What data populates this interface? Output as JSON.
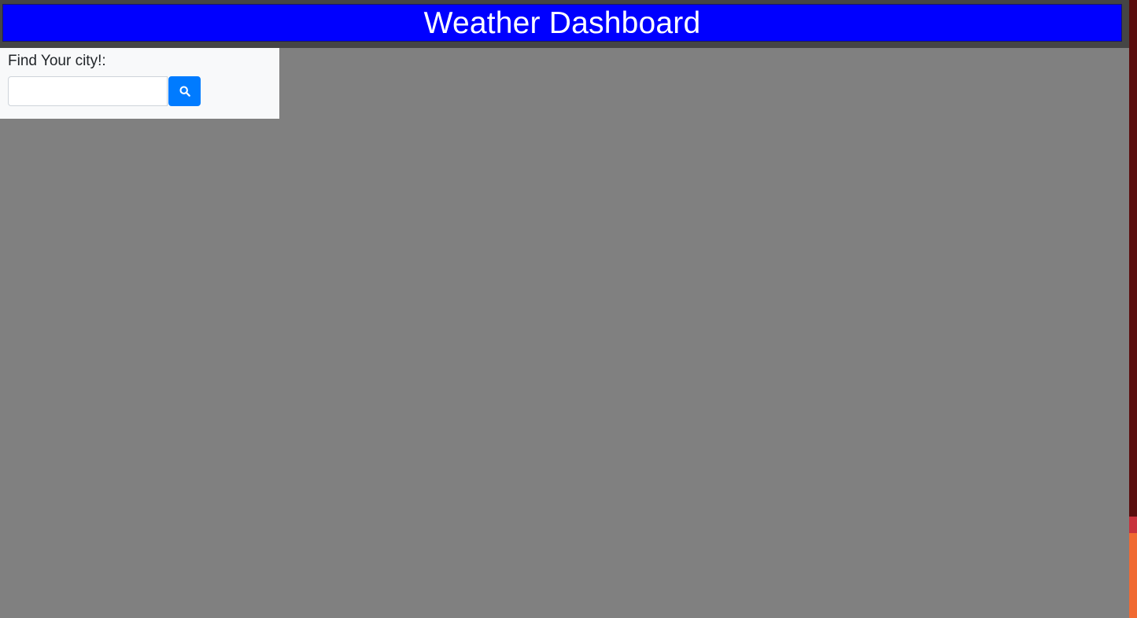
{
  "header": {
    "title": "Weather Dashboard",
    "background_color": "#0000ff",
    "text_color": "#ffffff"
  },
  "search": {
    "label": "Find Your city!:",
    "value": "",
    "button_icon": "search-icon",
    "button_color": "#007bff"
  },
  "main": {
    "background_color": "#808080"
  }
}
